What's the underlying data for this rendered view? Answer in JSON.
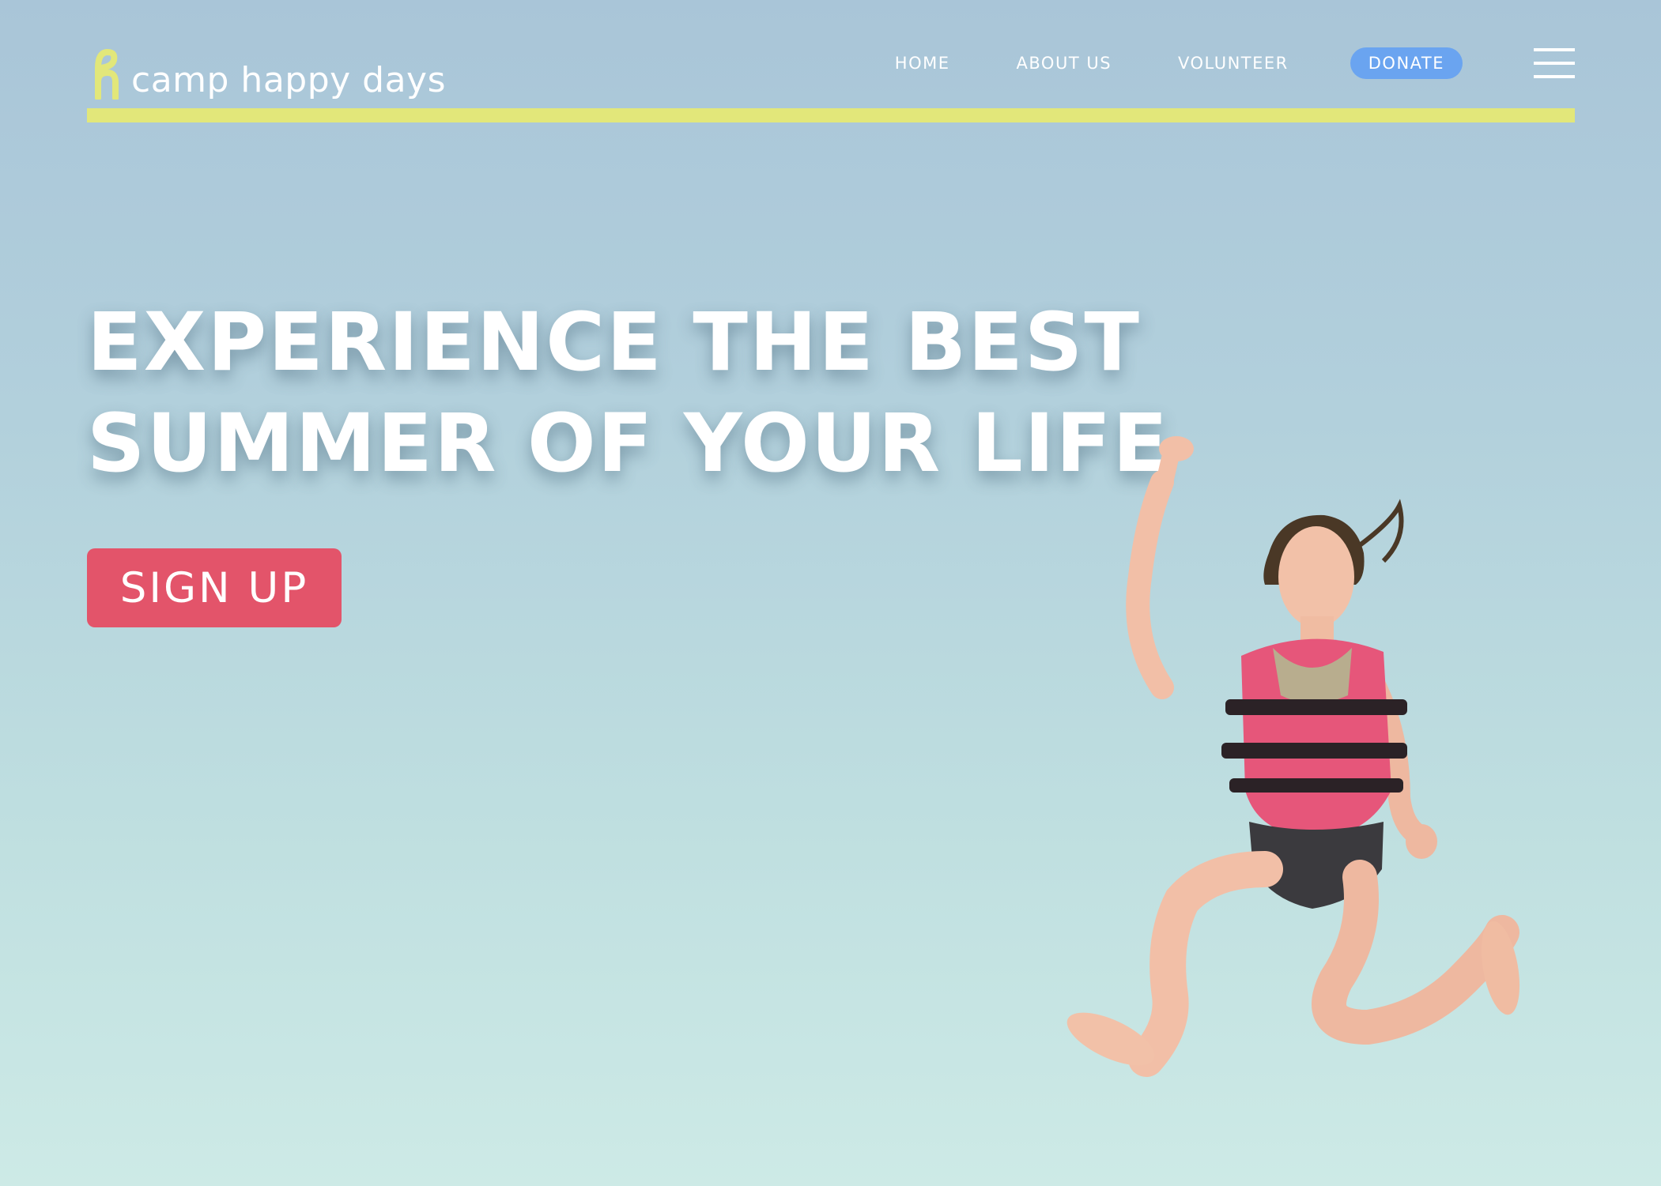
{
  "brand": {
    "name": "camp happy days",
    "logo_icon": "hd-monogram-icon",
    "accent_color": "#e2e77a"
  },
  "nav": {
    "items": [
      {
        "label": "HOME"
      },
      {
        "label": "ABOUT US"
      },
      {
        "label": "VOLUNTEER"
      }
    ],
    "donate_label": "DONATE",
    "donate_color": "#6aa4f0",
    "menu_icon": "hamburger-menu-icon"
  },
  "hero": {
    "title_line1": "EXPERIENCE THE BEST",
    "title_line2": "SUMMER OF YOUR LIFE",
    "cta_label": "SIGN UP",
    "cta_color": "#e3546a",
    "image": "girl-jumping-in-life-jacket-photo"
  }
}
